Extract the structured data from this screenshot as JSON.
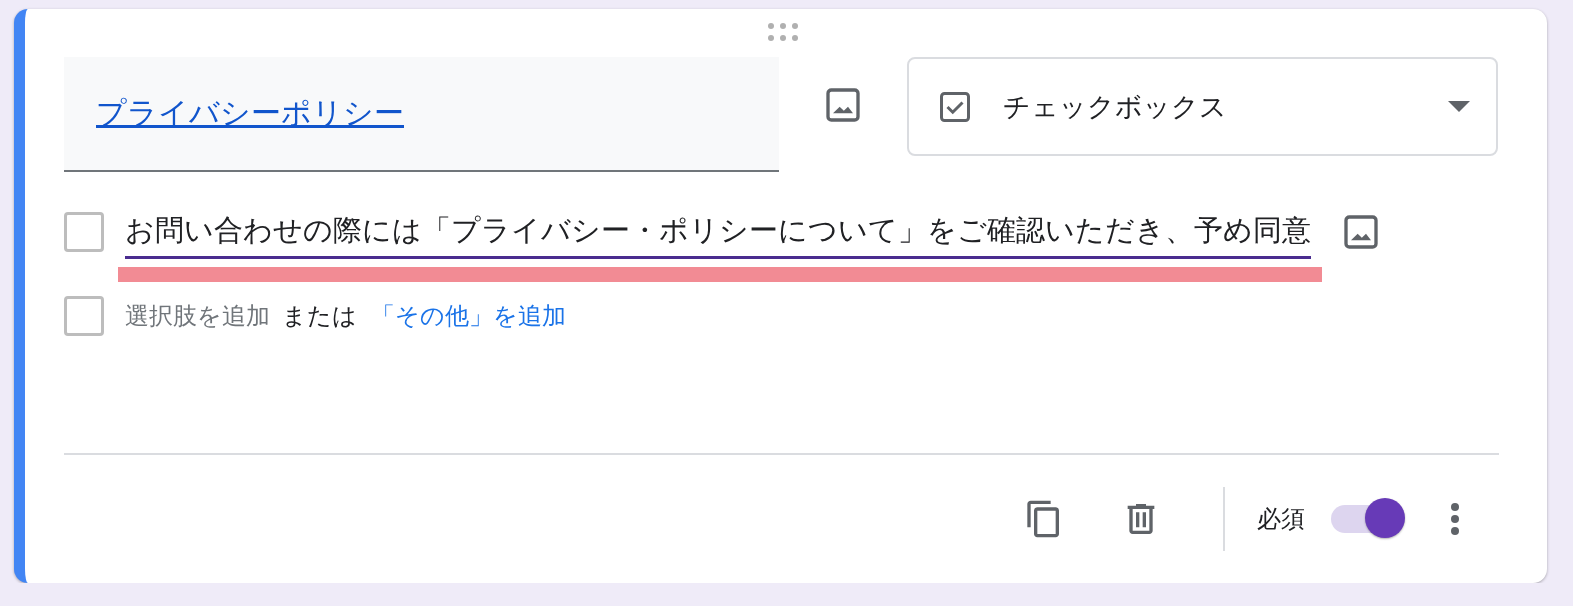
{
  "question": {
    "title": "プライバシーポリシー",
    "focused": true
  },
  "type_dropdown": {
    "label": "チェックボックス"
  },
  "options": [
    {
      "text": "お問い合わせの際には「プライバシー・ポリシーについて」をご確認いただき、予め同意",
      "checked": false,
      "highlighted": true
    }
  ],
  "add_option": {
    "checked": false,
    "add_label": "選択肢を追加",
    "or_text": "または",
    "other_link": "「その他」を追加"
  },
  "footer": {
    "required_label": "必須",
    "required": true
  }
}
